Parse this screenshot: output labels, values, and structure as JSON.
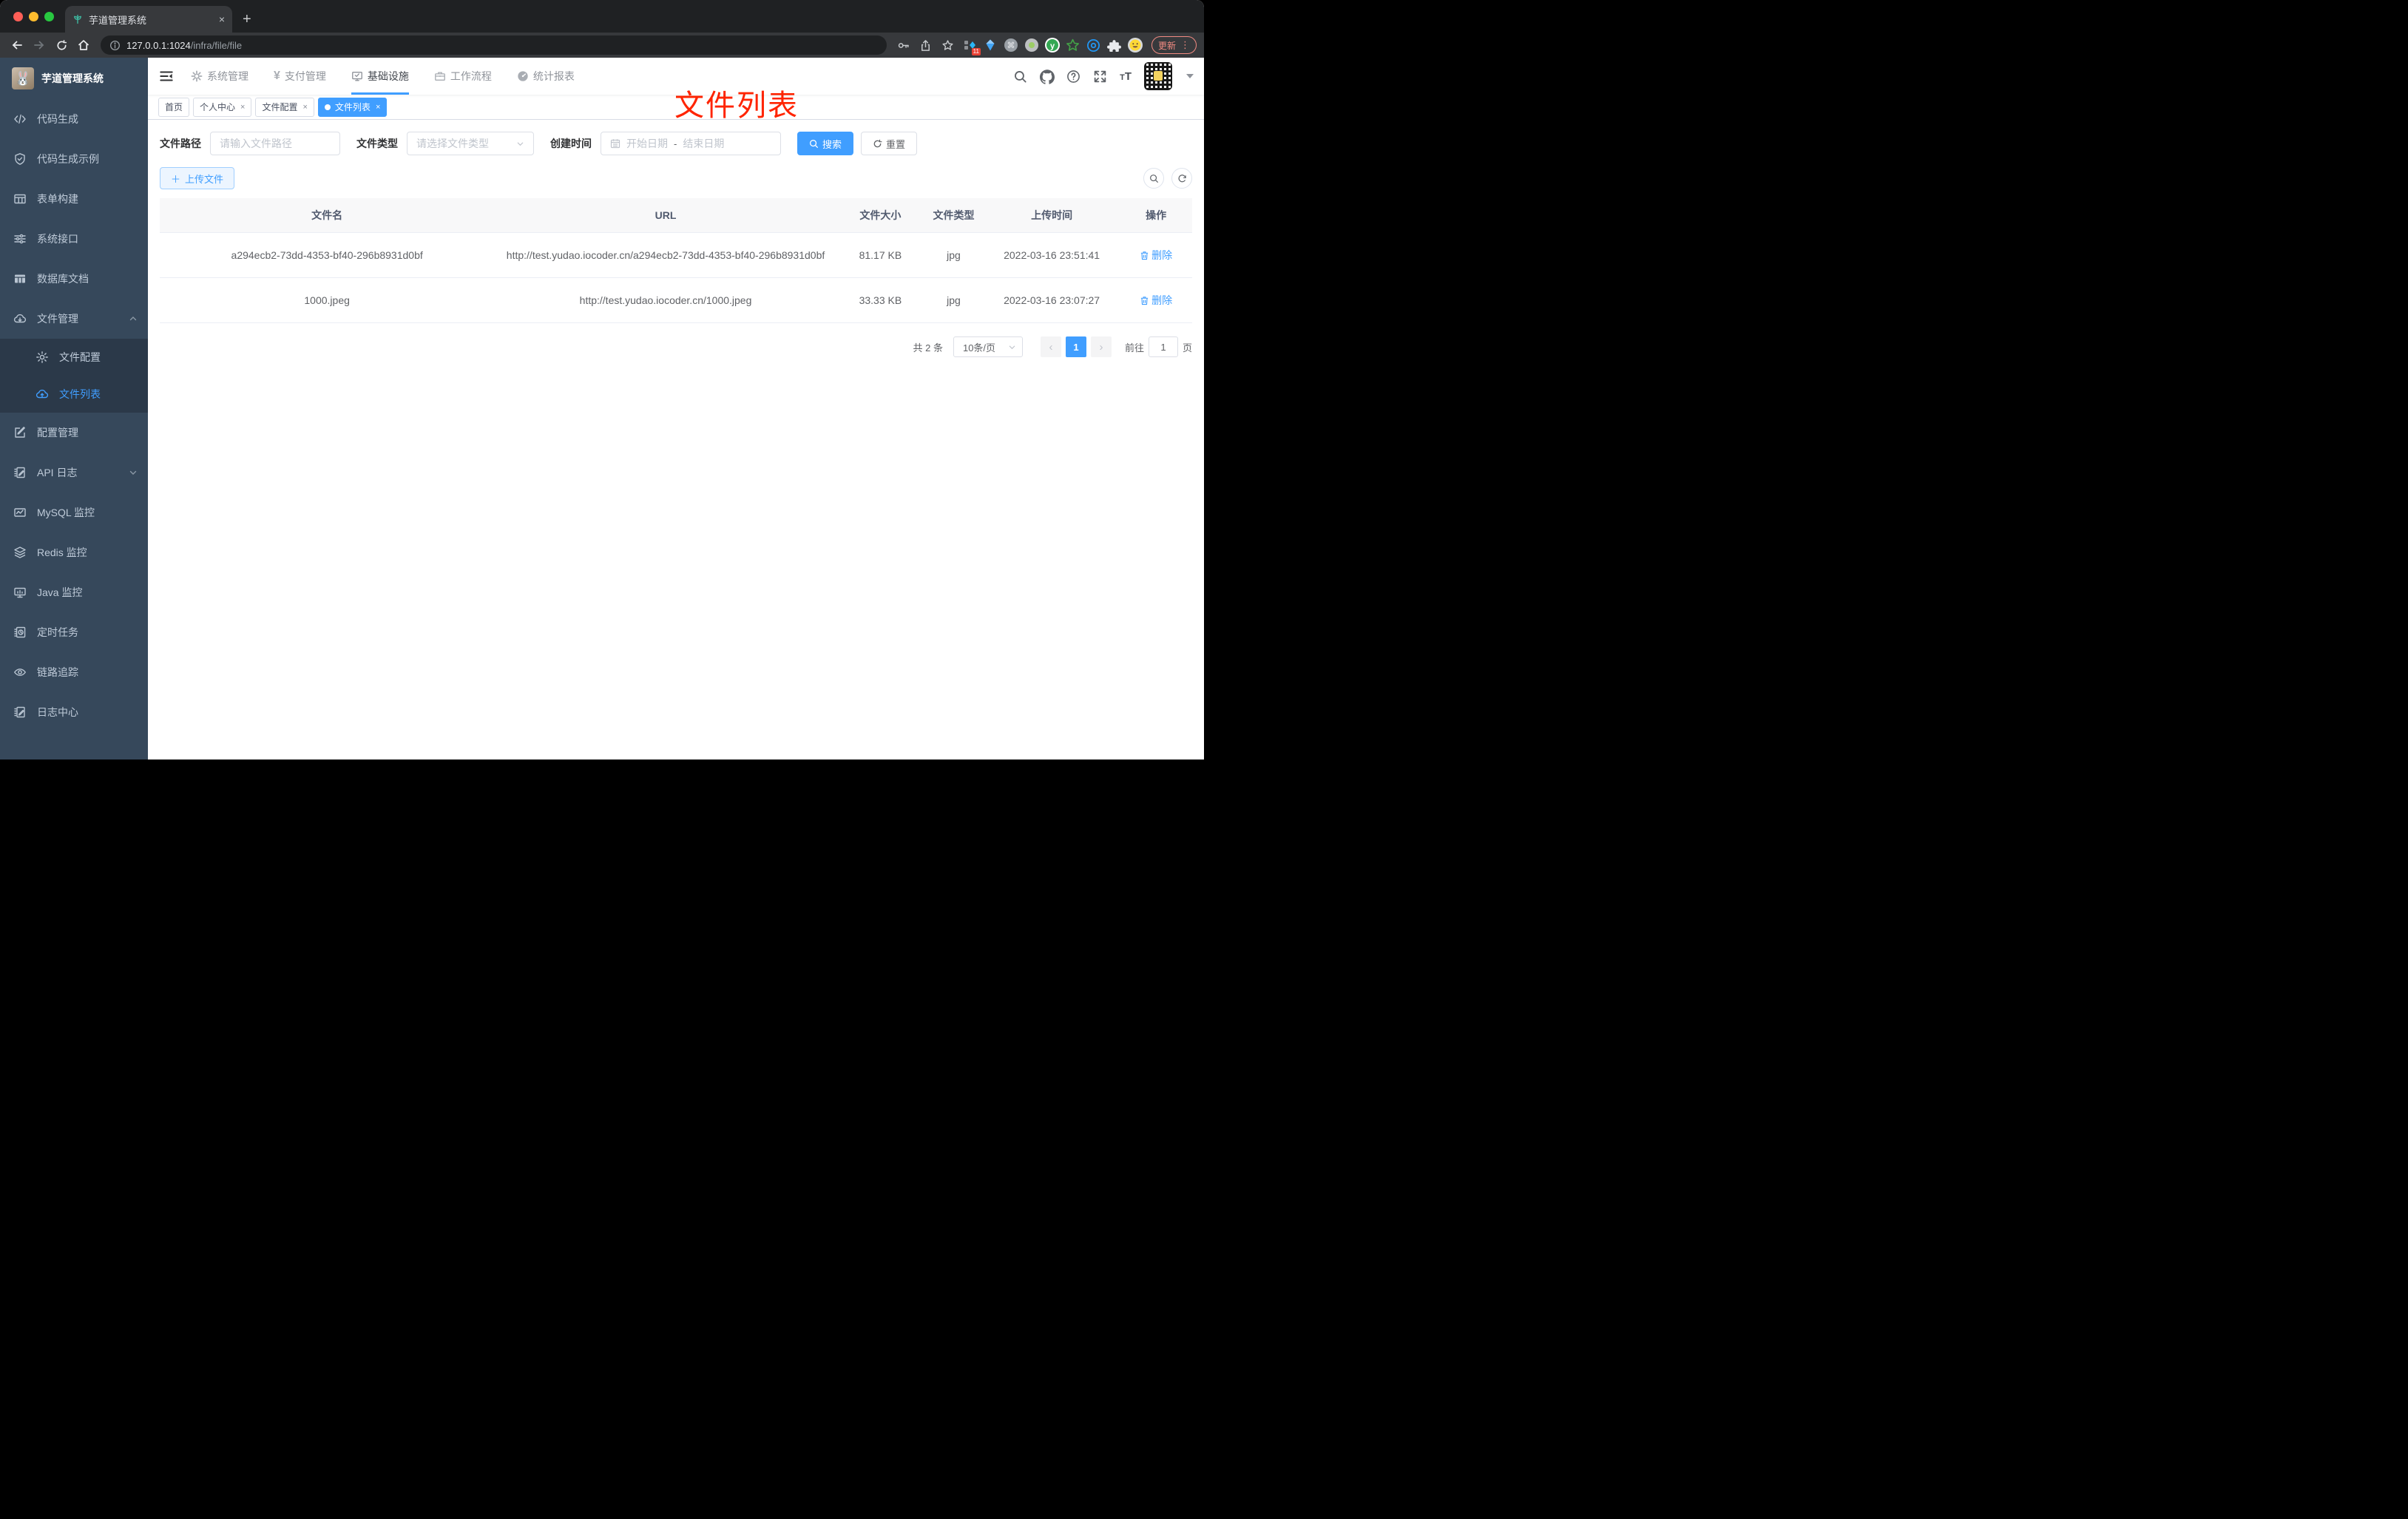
{
  "window": {
    "tab_title": "芋道管理系统",
    "url_host": "127.0.0.1:1024",
    "url_path": "/infra/file/file",
    "update_label": "更新",
    "extension_badge": "11",
    "new_tab": "+",
    "tab_close": "×"
  },
  "sidebar": {
    "logo_title": "芋道管理系统",
    "items": [
      {
        "label": "代码生成"
      },
      {
        "label": "代码生成示例"
      },
      {
        "label": "表单构建"
      },
      {
        "label": "系统接口"
      },
      {
        "label": "数据库文档"
      },
      {
        "label": "文件管理"
      },
      {
        "label": "文件配置"
      },
      {
        "label": "文件列表"
      },
      {
        "label": "配置管理"
      },
      {
        "label": "API 日志"
      },
      {
        "label": "MySQL 监控"
      },
      {
        "label": "Redis 监控"
      },
      {
        "label": "Java 监控"
      },
      {
        "label": "定时任务"
      },
      {
        "label": "链路追踪"
      },
      {
        "label": "日志中心"
      }
    ]
  },
  "topnav": {
    "items": [
      {
        "label": "系统管理"
      },
      {
        "label": "支付管理"
      },
      {
        "label": "基础设施"
      },
      {
        "label": "工作流程"
      },
      {
        "label": "统计报表"
      }
    ]
  },
  "tags": {
    "items": [
      {
        "label": "首页"
      },
      {
        "label": "个人中心"
      },
      {
        "label": "文件配置"
      },
      {
        "label": "文件列表"
      }
    ],
    "close": "×"
  },
  "annotation": {
    "text": "文件列表",
    "color": "#ff2400"
  },
  "filters": {
    "path_label": "文件路径",
    "path_placeholder": "请输入文件路径",
    "type_label": "文件类型",
    "type_placeholder": "请选择文件类型",
    "date_label": "创建时间",
    "date_start": "开始日期",
    "date_separator": "-",
    "date_end": "结束日期",
    "search_label": "搜索",
    "reset_label": "重置"
  },
  "toolbar": {
    "upload_label": "上传文件"
  },
  "table": {
    "headers": [
      "文件名",
      "URL",
      "文件大小",
      "文件类型",
      "上传时间",
      "操作"
    ],
    "rows": [
      {
        "name": "a294ecb2-73dd-4353-bf40-296b8931d0bf",
        "url": "http://test.yudao.iocoder.cn/a294ecb2-73dd-4353-bf40-296b8931d0bf",
        "size": "81.17 KB",
        "type": "jpg",
        "time": "2022-03-16 23:51:41",
        "action": "删除"
      },
      {
        "name": "1000.jpeg",
        "url": "http://test.yudao.iocoder.cn/1000.jpeg",
        "size": "33.33 KB",
        "type": "jpg",
        "time": "2022-03-16 23:07:27",
        "action": "删除"
      }
    ]
  },
  "pagination": {
    "total": "共 2 条",
    "page_size": "10条/页",
    "prev": "‹",
    "current_page": "1",
    "next": "›",
    "goto_label": "前往",
    "goto_value": "1",
    "page_unit": "页"
  },
  "colors": {
    "accent": "#409eff",
    "annotation_red": "#ff2400",
    "sidebar_bg": "#36485b",
    "submenu_bg": "#2b3949",
    "update_red": "#f28b82"
  }
}
